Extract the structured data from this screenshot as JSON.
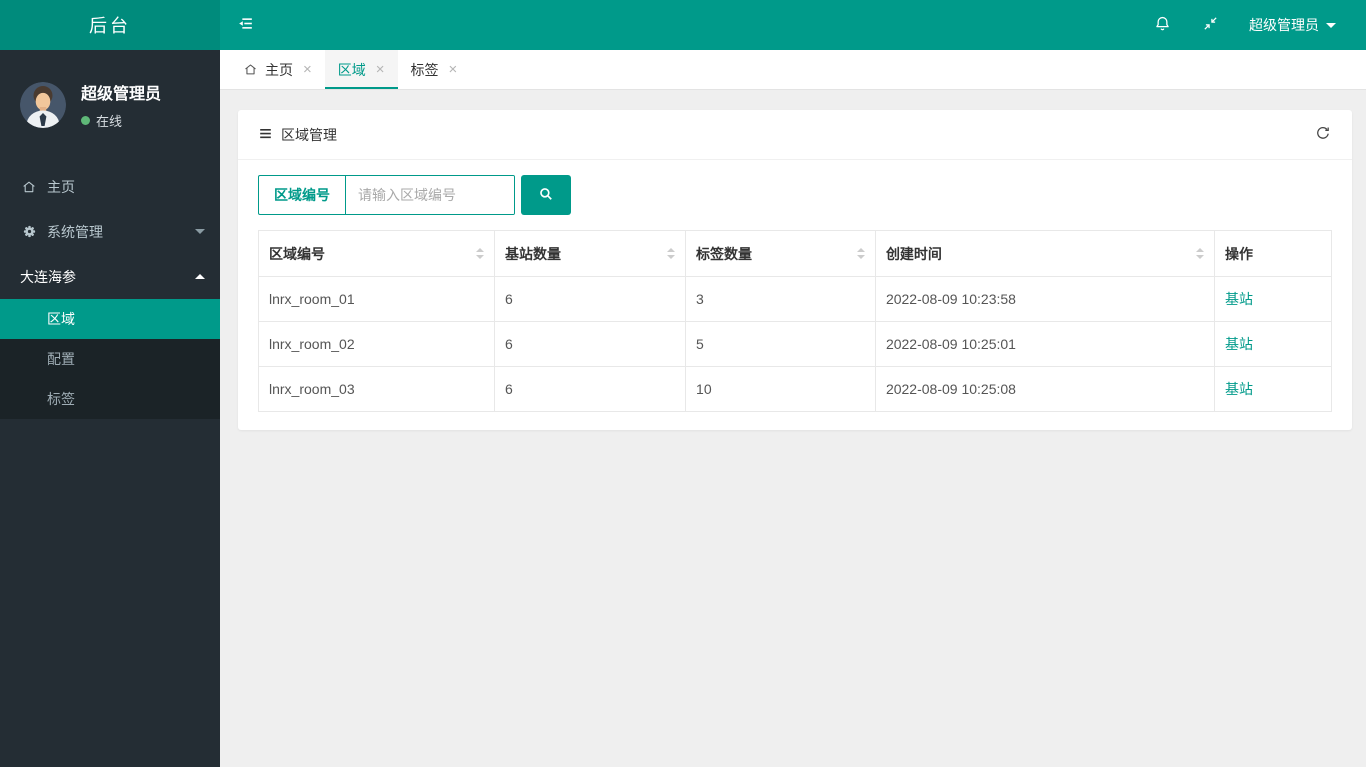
{
  "colors": {
    "accent": "#009a8a",
    "logo_bg": "#008b7c",
    "sidebar_bg": "#242d34",
    "submenu_bg": "#1b2327",
    "content_bg": "#efefef",
    "online_green": "#5fb878"
  },
  "header": {
    "logo": "后台",
    "user_menu_label": "超级管理员"
  },
  "sidebar": {
    "user": {
      "name": "超级管理员",
      "status": "在线"
    },
    "items": [
      {
        "label": "主页"
      },
      {
        "label": "系统管理"
      },
      {
        "label": "大连海参"
      }
    ],
    "submenu": [
      {
        "label": "区域"
      },
      {
        "label": "配置"
      },
      {
        "label": "标签"
      }
    ]
  },
  "tabs": [
    {
      "label": "主页"
    },
    {
      "label": "区域"
    },
    {
      "label": "标签"
    }
  ],
  "panel": {
    "title": "区域管理",
    "search": {
      "field_label": "区域编号",
      "placeholder": "请输入区域编号"
    },
    "table": {
      "columns": [
        {
          "label": "区域编号"
        },
        {
          "label": "基站数量"
        },
        {
          "label": "标签数量"
        },
        {
          "label": "创建时间"
        },
        {
          "label": "操作"
        }
      ],
      "rows": [
        {
          "area_id": "lnrx_room_01",
          "base_count": "6",
          "tag_count": "3",
          "created": "2022-08-09 10:23:58",
          "action": "基站"
        },
        {
          "area_id": "lnrx_room_02",
          "base_count": "6",
          "tag_count": "5",
          "created": "2022-08-09 10:25:01",
          "action": "基站"
        },
        {
          "area_id": "lnrx_room_03",
          "base_count": "6",
          "tag_count": "10",
          "created": "2022-08-09 10:25:08",
          "action": "基站"
        }
      ]
    }
  }
}
